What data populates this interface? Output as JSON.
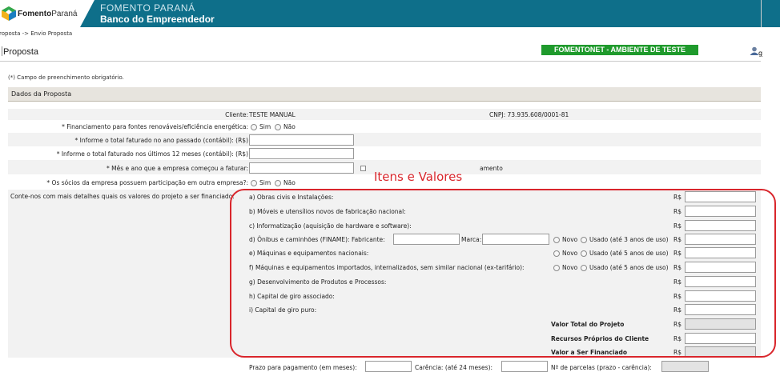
{
  "header": {
    "logo_text_1": "Fomento",
    "logo_text_2": "Paraná",
    "title_line1": "FOMENTO PARANÁ",
    "title_line2": "Banco do Empreendedor"
  },
  "breadcrumb": "roposta -> Envio Proposta",
  "page_title": "Proposta",
  "env_badge": "FOMENTONET - AMBIENTE DE TESTE",
  "user_link": "g",
  "required_note": "(*) Campo de preenchimento obrigatório.",
  "section_title": "Dados da Proposta",
  "client": {
    "label": "Cliente:",
    "value": "TESTE MANUAL",
    "cnpj_label": "CNPJ:",
    "cnpj_value": "73.935.608/0001-81"
  },
  "fields": {
    "renovaveis_label": "* Financiamento para fontes renováveis/eficiência energética:",
    "sim": "Sim",
    "nao": "Não",
    "faturado_ano_label": "* Informe o total faturado no ano passado (contábil): (R$)",
    "faturado_12_label": "* Informe o total faturado nos últimos 12 meses (contábil): (R$)",
    "mes_ano_label": "* Mês e ano que a empresa começou a faturar:",
    "mes_ano_suffix": "amento",
    "socios_label": "* Os sócios da empresa possuem participação em outra empresa?:",
    "detalhes_label": "Conte-nos com mais detalhes quais os valores do projeto a ser financiado:"
  },
  "annotation": "Itens e Valores",
  "currency": "R$",
  "items": [
    {
      "label": "a) Obras civis e Instalações:"
    },
    {
      "label": "b) Móveis e utensílios novos de fabricação nacional:"
    },
    {
      "label": "c) Informatização (aquisição de hardware e software):"
    },
    {
      "label": "d) Ônibus e caminhões (FINAME): Fabricante:",
      "marca": "Marca:",
      "novo": "Novo",
      "usado": "Usado (até 3 anos de uso)"
    },
    {
      "label": "e) Máquinas e equipamentos nacionais:",
      "novo": "Novo",
      "usado": "Usado (até 5 anos de uso)"
    },
    {
      "label": "f) Máquinas e equipamentos importados, internalizados, sem similar nacional (ex-tarifário):",
      "novo": "Novo",
      "usado": "Usado (até 5 anos de uso)"
    },
    {
      "label": "g) Desenvolvimento de Produtos e Processos:"
    },
    {
      "label": "h) Capital de giro associado:"
    },
    {
      "label": "i) Capital de giro puro:"
    }
  ],
  "totals": {
    "valor_total": "Valor Total do Projeto",
    "recursos_proprios": "Recursos Próprios do Cliente",
    "valor_financiado": "Valor a Ser Financiado"
  },
  "bottom": {
    "prazo_label": "Prazo para pagamento (em meses):",
    "carencia_label": "Carência: (até 24 meses):",
    "parcelas_label": "Nº de parcelas (prazo - carência):"
  },
  "colors": {
    "header_bg": "#0e6f8a",
    "badge_bg": "#1f9a2c",
    "annotation": "#d9262c",
    "section_bg": "#e7e4de"
  }
}
